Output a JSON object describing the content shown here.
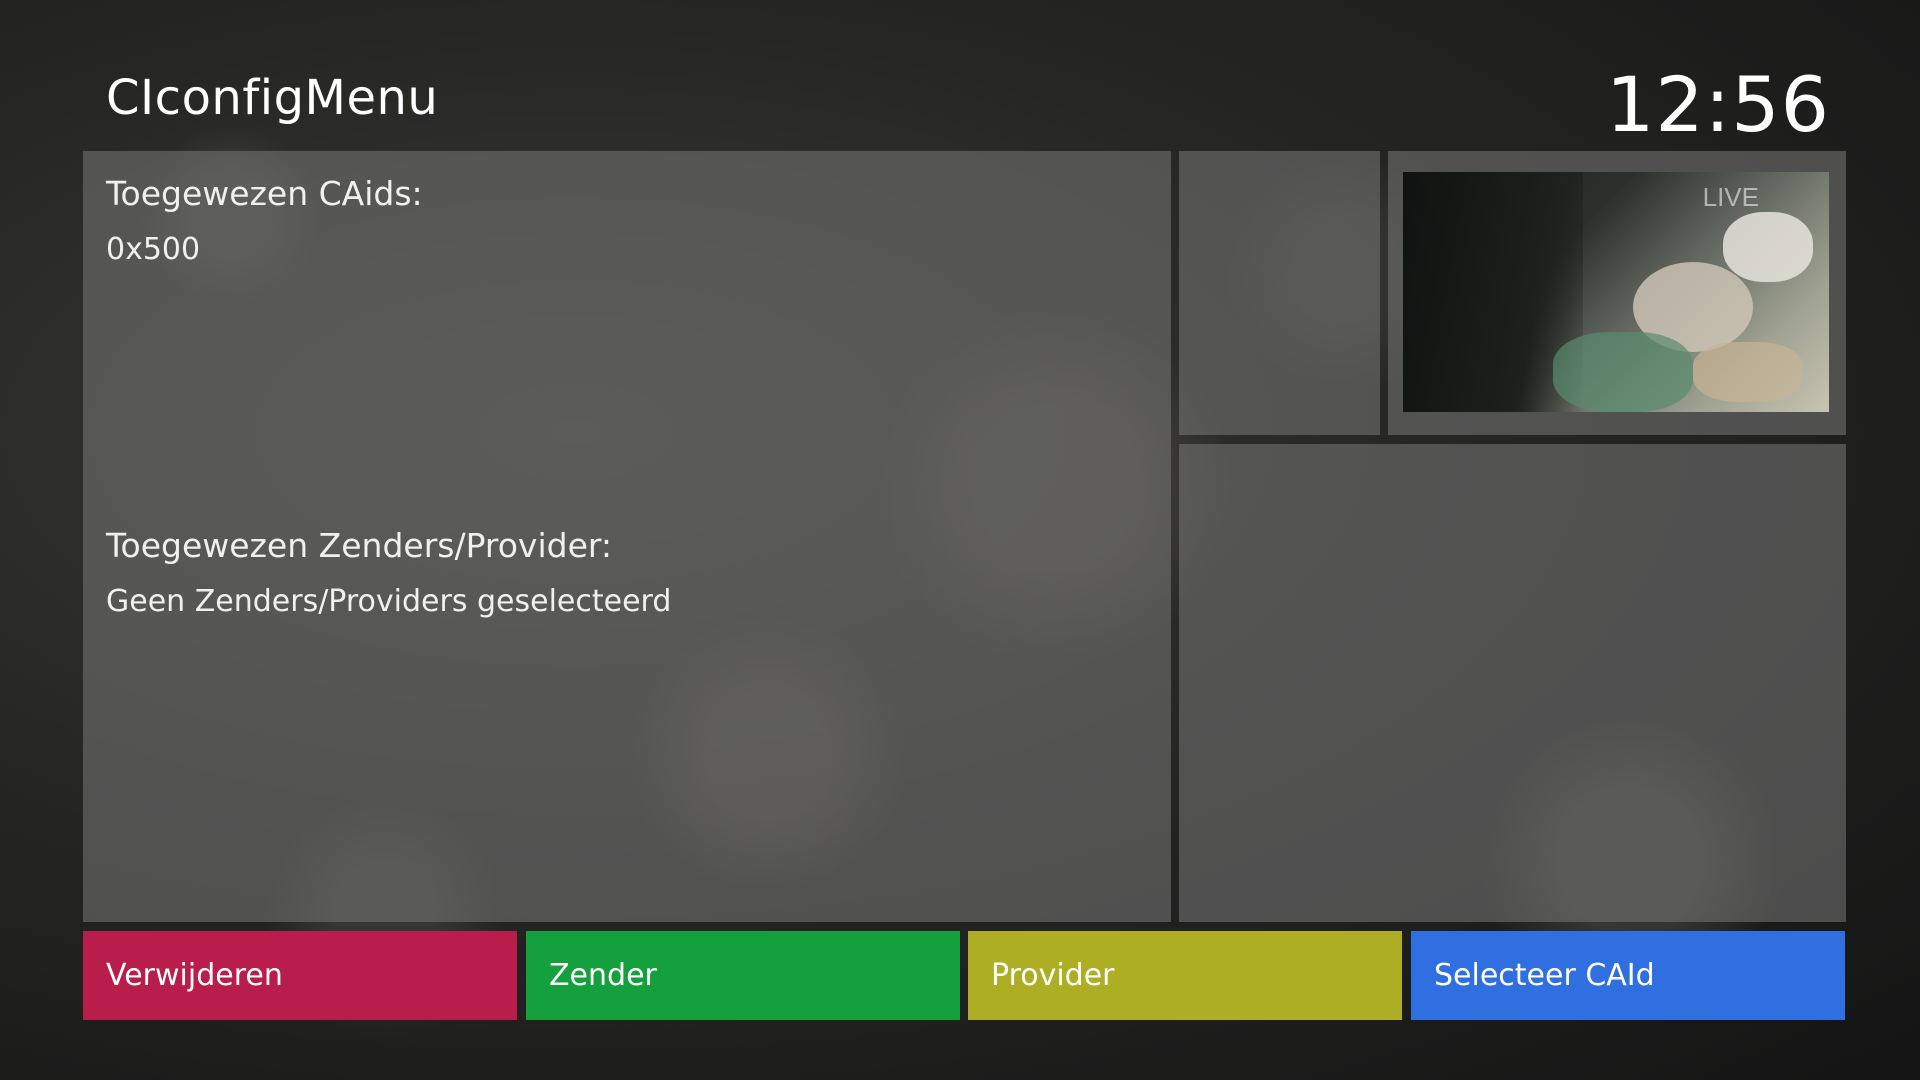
{
  "header": {
    "title": "CIconfigMenu",
    "clock": "12:56"
  },
  "main": {
    "caids_heading": "Toegewezen CAids:",
    "caids_value": "0x500",
    "providers_heading": "Toegewezen Zenders/Provider:",
    "providers_value": "Geen Zenders/Providers geselecteerd"
  },
  "preview": {
    "live_label": "LIVE"
  },
  "buttons": {
    "red": "Verwijderen",
    "green": "Zender",
    "yellow": "Provider",
    "blue": "Selecteer CAId"
  },
  "colors": {
    "red": "#b81d4c",
    "green": "#14a03c",
    "yellow": "#aeae24",
    "blue": "#2f6fe0"
  }
}
